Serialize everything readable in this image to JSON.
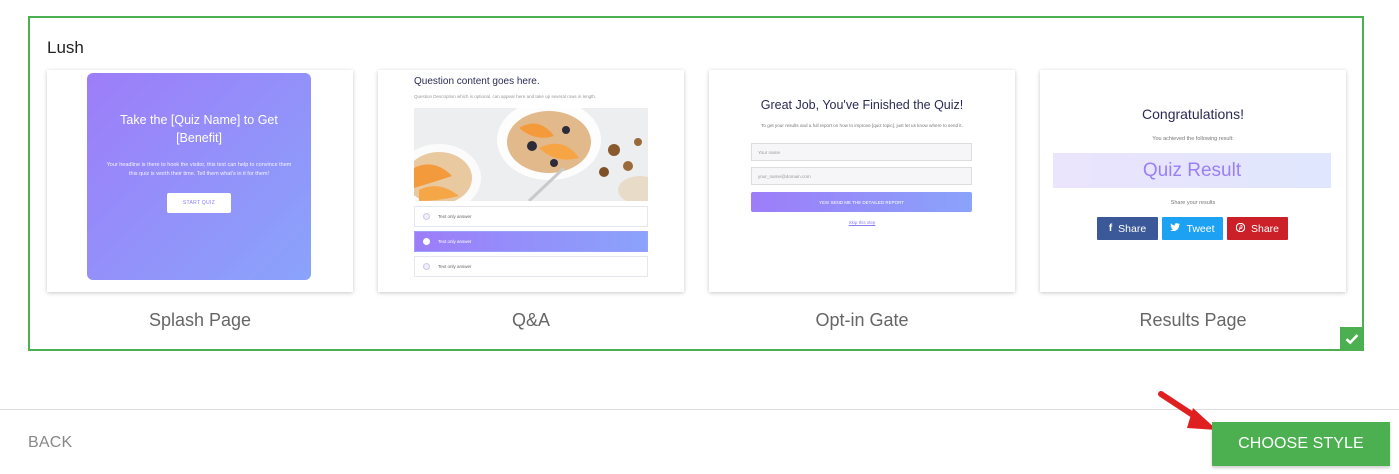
{
  "style_panel": {
    "title": "Lush",
    "selected": true,
    "check_icon": "check-icon"
  },
  "cards": {
    "splash": {
      "label": "Splash Page",
      "heading": "Take the [Quiz Name] to Get [Benefit]",
      "body": "Your headline is there to hook the visitor, this text can help to convince them this quiz is worth their time. Tell them what's in it for them!",
      "button": "START QUIZ"
    },
    "qa": {
      "label": "Q&A",
      "question": "Question content goes here.",
      "description": "Question Description which is optional, can appear here and take up several rows in length.",
      "answers": [
        "Text only answer",
        "Text only answer",
        "Text only answer"
      ],
      "selected_index": 1
    },
    "optin": {
      "label": "Opt-in Gate",
      "heading": "Great Job, You've Finished the Quiz!",
      "description": "To get your results and a full report on how to improve [quiz topic], just let us know where to send it.",
      "name_placeholder": "Your name",
      "email_placeholder": "your_name@domain.com",
      "button": "YES! SEND ME THE DETAILED REPORT",
      "skip": "Skip this step"
    },
    "results": {
      "label": "Results Page",
      "heading": "Congratulations!",
      "subheading": "You achieved the following result:",
      "result": "Quiz Result",
      "share_prompt": "Share your results",
      "buttons": [
        {
          "label": "Share",
          "icon": "facebook-icon",
          "glyph": "f",
          "color": "#3b5998"
        },
        {
          "label": "Tweet",
          "icon": "twitter-icon",
          "glyph": "🐦",
          "color": "#1da1f2"
        },
        {
          "label": "Share",
          "icon": "pinterest-icon",
          "glyph": "⊗",
          "color": "#cb2027"
        }
      ]
    }
  },
  "footer": {
    "back": "BACK",
    "choose": "CHOOSE STYLE"
  },
  "colors": {
    "accent_green": "#4caf50",
    "lush_purple": "#9d7df9",
    "lush_blue": "#8aa3fb",
    "arrow_red": "#e02020"
  }
}
